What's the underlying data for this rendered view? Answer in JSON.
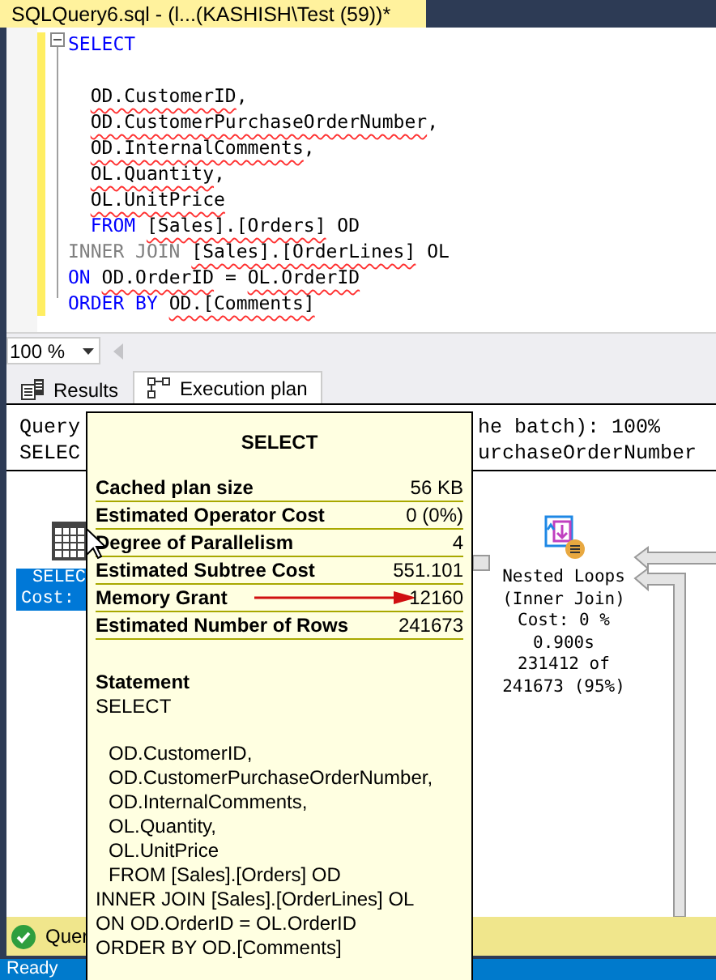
{
  "document_tab": {
    "title": "SQLQuery6.sql - (l...(KASHISH\\Test (59))*"
  },
  "editor": {
    "lines": [
      {
        "indent": false,
        "space_before": false,
        "tokens": [
          {
            "kind": "keyword",
            "text": "SELECT"
          }
        ]
      },
      {
        "indent": true,
        "space_before": true,
        "tokens": [
          {
            "kind": "ident",
            "text": "OD.CustomerID"
          },
          {
            "kind": "plain",
            "text": ","
          }
        ]
      },
      {
        "indent": true,
        "space_before": false,
        "tokens": [
          {
            "kind": "ident",
            "text": "OD.CustomerPurchaseOrderNumber"
          },
          {
            "kind": "plain",
            "text": ","
          }
        ]
      },
      {
        "indent": true,
        "space_before": false,
        "tokens": [
          {
            "kind": "ident",
            "text": "OD.InternalComments"
          },
          {
            "kind": "plain",
            "text": ","
          }
        ]
      },
      {
        "indent": true,
        "space_before": false,
        "tokens": [
          {
            "kind": "ident",
            "text": "OL.Quantity"
          },
          {
            "kind": "plain",
            "text": ","
          }
        ]
      },
      {
        "indent": true,
        "space_before": false,
        "tokens": [
          {
            "kind": "ident",
            "text": "OL.UnitPrice"
          }
        ]
      },
      {
        "indent": true,
        "space_before": false,
        "tokens": [
          {
            "kind": "keyword",
            "text": "FROM "
          },
          {
            "kind": "ident",
            "text": "[Sales].[Orders]"
          },
          {
            "kind": "plain",
            "text": " OD"
          }
        ]
      },
      {
        "indent": false,
        "space_before": false,
        "tokens": [
          {
            "kind": "gray",
            "text": "INNER JOIN "
          },
          {
            "kind": "ident",
            "text": "[Sales].[OrderLines]"
          },
          {
            "kind": "plain",
            "text": " OL"
          }
        ]
      },
      {
        "indent": false,
        "space_before": false,
        "tokens": [
          {
            "kind": "keyword",
            "text": "ON "
          },
          {
            "kind": "ident",
            "text": "OD.OrderID"
          },
          {
            "kind": "plain",
            "text": " = "
          },
          {
            "kind": "ident",
            "text": "OL.OrderID"
          }
        ]
      },
      {
        "indent": false,
        "space_before": false,
        "tokens": [
          {
            "kind": "keyword",
            "text": "ORDER BY "
          },
          {
            "kind": "ident",
            "text": "OD.[Comments]"
          }
        ]
      }
    ]
  },
  "zoom": {
    "value": "100 %"
  },
  "result_tabs": [
    {
      "label": "Results",
      "selected": false
    },
    {
      "label": "Execution plan",
      "selected": true
    }
  ],
  "plan": {
    "header_lines": [
      {
        "left": "Query",
        "right": "he batch): 100%"
      },
      {
        "left": "SELEC",
        "right": "urchaseOrderNumber"
      }
    ],
    "nodes": [
      {
        "kind": "select",
        "selected": true,
        "lines": [
          "SELEC",
          "Cost:"
        ]
      },
      {
        "kind": "nested_loops",
        "selected": false,
        "lines": [
          "Nested Loops",
          "(Inner Join)",
          "Cost: 0 %",
          "0.900s",
          "231412 of",
          "241673 (95%)"
        ]
      }
    ]
  },
  "tooltip": {
    "title": "SELECT",
    "properties": [
      {
        "label": "Cached plan size",
        "value": "56 KB"
      },
      {
        "label": "Estimated Operator Cost",
        "value": "0 (0%)"
      },
      {
        "label": "Degree of Parallelism",
        "value": "4"
      },
      {
        "label": "Estimated Subtree Cost",
        "value": "551.101"
      },
      {
        "label": "Memory Grant",
        "value": "12160"
      },
      {
        "label": "Estimated Number of Rows",
        "value": "241673"
      }
    ],
    "statement_heading": "Statement",
    "statement_lines": [
      {
        "text": "SELECT",
        "indent": false,
        "space_before": false
      },
      {
        "text": "OD.CustomerID,",
        "indent": true,
        "space_before": true
      },
      {
        "text": "OD.CustomerPurchaseOrderNumber,",
        "indent": true,
        "space_before": false
      },
      {
        "text": "OD.InternalComments,",
        "indent": true,
        "space_before": false
      },
      {
        "text": "OL.Quantity,",
        "indent": true,
        "space_before": false
      },
      {
        "text": "OL.UnitPrice",
        "indent": true,
        "space_before": false
      },
      {
        "text": "FROM [Sales].[Orders] OD",
        "indent": true,
        "space_before": false
      },
      {
        "text": "INNER JOIN [Sales].[OrderLines] OL",
        "indent": false,
        "space_before": false
      },
      {
        "text": "ON OD.OrderID = OL.OrderID",
        "indent": false,
        "space_before": false
      },
      {
        "text": "ORDER BY OD.[Comments]",
        "indent": false,
        "space_before": false
      }
    ]
  },
  "query_status": {
    "text": "Quer"
  },
  "status_bar": {
    "text": "Ready"
  }
}
